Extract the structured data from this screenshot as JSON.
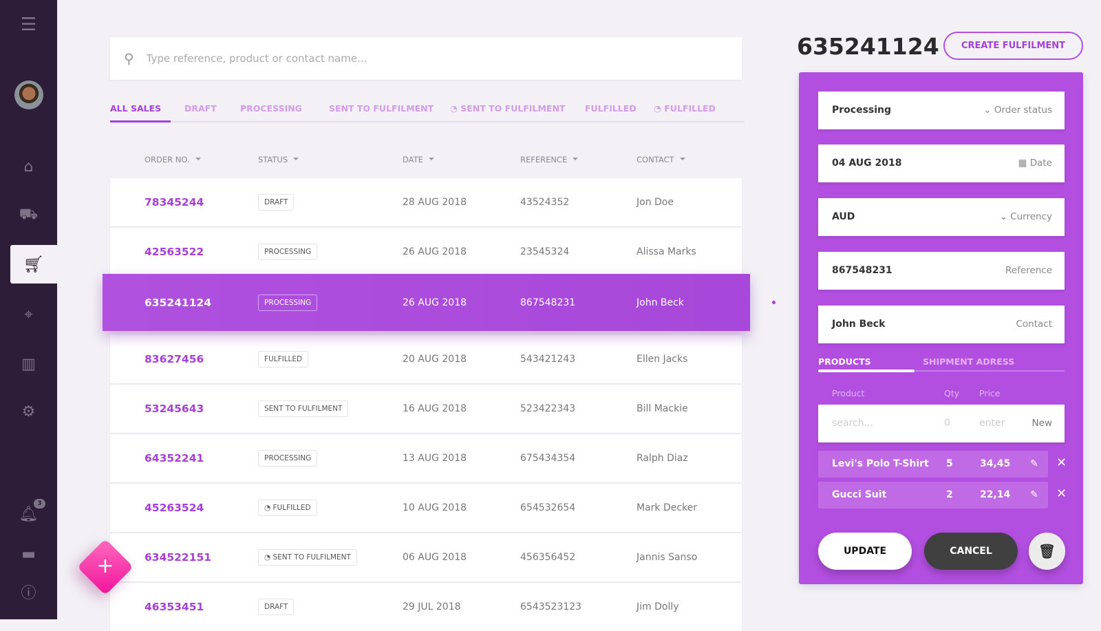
{
  "sidebar": {
    "items": [
      "menu-icon",
      "home-icon",
      "trolley-icon",
      "cart-icon",
      "tag-icon",
      "barcode-icon",
      "gear-icon",
      "bell-icon",
      "chat-icon",
      "info-icon"
    ],
    "active": "cart-icon",
    "notification_count": "3"
  },
  "search": {
    "placeholder": "Type reference, product or contact name..."
  },
  "tabs": [
    {
      "label": "ALL SALES"
    },
    {
      "label": "DRAFT"
    },
    {
      "label": "PROCESSING"
    },
    {
      "label": "SENT TO FULFILMENT"
    },
    {
      "label": "SENT TO FULFILMENT"
    },
    {
      "label": "FULFILLED"
    },
    {
      "label": "FULFILLED"
    }
  ],
  "columns": [
    "ORDER NO.",
    "STATUS",
    "DATE",
    "REFERENCE",
    "CONTACT"
  ],
  "rows": [
    {
      "order": "78345244",
      "status": "DRAFT",
      "date": "28 AUG 2018",
      "reference": "43524352",
      "contact": "Jon Doe"
    },
    {
      "order": "42563522",
      "status": "PROCESSING",
      "date": "26 AUG 2018",
      "reference": "23545324",
      "contact": "Alissa Marks"
    },
    {
      "order": "635241124",
      "status": "PROCESSING",
      "date": "26 AUG 2018",
      "reference": "867548231",
      "contact": "John Beck"
    },
    {
      "order": "83627456",
      "status": "FULFILLED",
      "date": "20 AUG 2018",
      "reference": "543421243",
      "contact": "Ellen Jacks"
    },
    {
      "order": "53245643",
      "status": "SENT TO FULFILMENT",
      "date": "16 AUG 2018",
      "reference": "523422343",
      "contact": "Bill Mackie"
    },
    {
      "order": "64352241",
      "status": "PROCESSING",
      "date": "13 AUG 2018",
      "reference": "675434354",
      "contact": "Ralph Diaz"
    },
    {
      "order": "45263524",
      "status": "FULFILLED",
      "date": "10 AUG 2018",
      "reference": "654532654",
      "contact": "Mark Decker"
    },
    {
      "order": "634522151",
      "status": "SENT TO FULFILMENT",
      "date": "06 AUG 2018",
      "reference": "456356452",
      "contact": "Jannis Sanso"
    },
    {
      "order": "46353451",
      "status": "DRAFT",
      "date": "29 JUL 2018",
      "reference": "6543523123",
      "contact": "Jim Dolly"
    }
  ],
  "detail": {
    "title": "635241124",
    "create_label": "CREATE FULFILMENT",
    "fields": [
      {
        "value": "Processing",
        "label": "Order status"
      },
      {
        "value": "04 AUG 2018",
        "label": "Date"
      },
      {
        "value": "AUD",
        "label": "Currency"
      },
      {
        "value": "867548231",
        "label": "Reference"
      },
      {
        "value": "John Beck",
        "label": "Contact"
      }
    ],
    "tabs": [
      "PRODUCTS",
      "SHIPMENT ADRESS"
    ],
    "product_headers": [
      "Product",
      "Qty",
      "Price"
    ],
    "new_row": {
      "search_placeholder": "search...",
      "qty_placeholder": "0",
      "price_placeholder": "enter",
      "new_label": "New"
    },
    "products": [
      {
        "name": "Levi's Polo T-Shirt",
        "qty": "5",
        "price": "34,45"
      },
      {
        "name": "Gucci Suit",
        "qty": "2",
        "price": "22,14"
      }
    ],
    "update_label": "UPDATE",
    "cancel_label": "CANCEL"
  },
  "colors": {
    "accent": "#a73fd9",
    "panel": "#b24ee0",
    "sidebar": "#2e1d38",
    "fab": "#f0129a"
  }
}
